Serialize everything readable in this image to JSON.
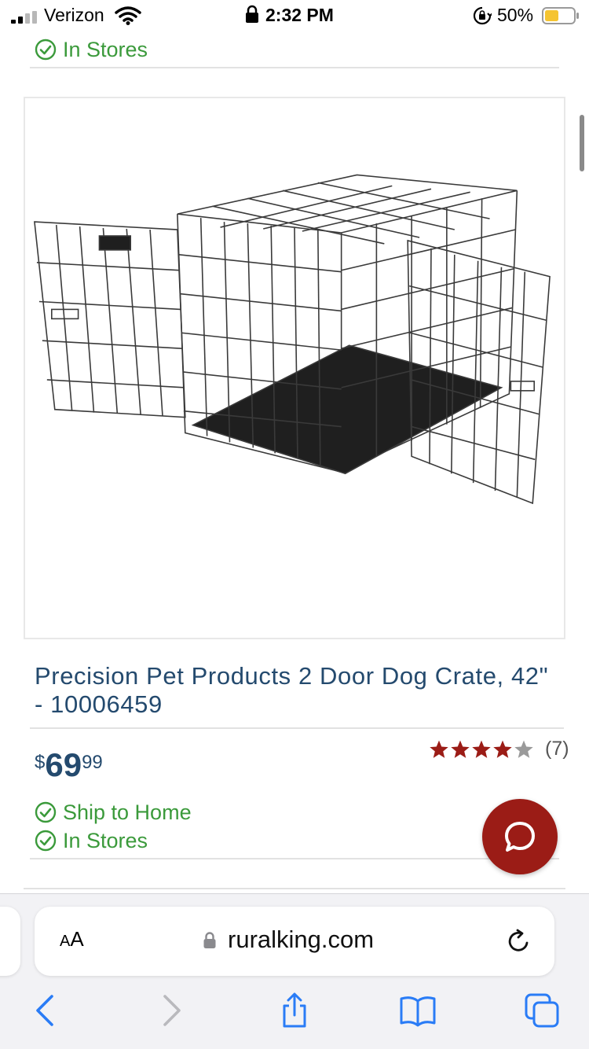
{
  "status_bar": {
    "carrier": "Verizon",
    "time": "2:32 PM",
    "battery_percent": "50%"
  },
  "previous_item": {
    "availability": "In Stores"
  },
  "product": {
    "image_alt": "Two door wire dog crate",
    "title": "Precision Pet Products 2 Door Dog Crate, 42\" - 10006459",
    "price": {
      "currency": "$",
      "dollars": "69",
      "cents": "99"
    },
    "rating": {
      "stars": 4,
      "max_stars": 5,
      "review_count": "(7)"
    },
    "availability": [
      {
        "label": "Ship to Home"
      },
      {
        "label": "In Stores"
      }
    ]
  },
  "browser": {
    "aa_big": "A",
    "aa_small": "A",
    "url": "ruralking.com"
  },
  "icons": {
    "availability": "check-circle-icon",
    "chat": "chat-bubble-icon",
    "star_filled_color": "#9b1c16",
    "star_empty_color": "#9a9a9a",
    "accent_green": "#3b9a3b",
    "title_color": "#244a6e",
    "safari_blue": "#2a7cf6"
  }
}
